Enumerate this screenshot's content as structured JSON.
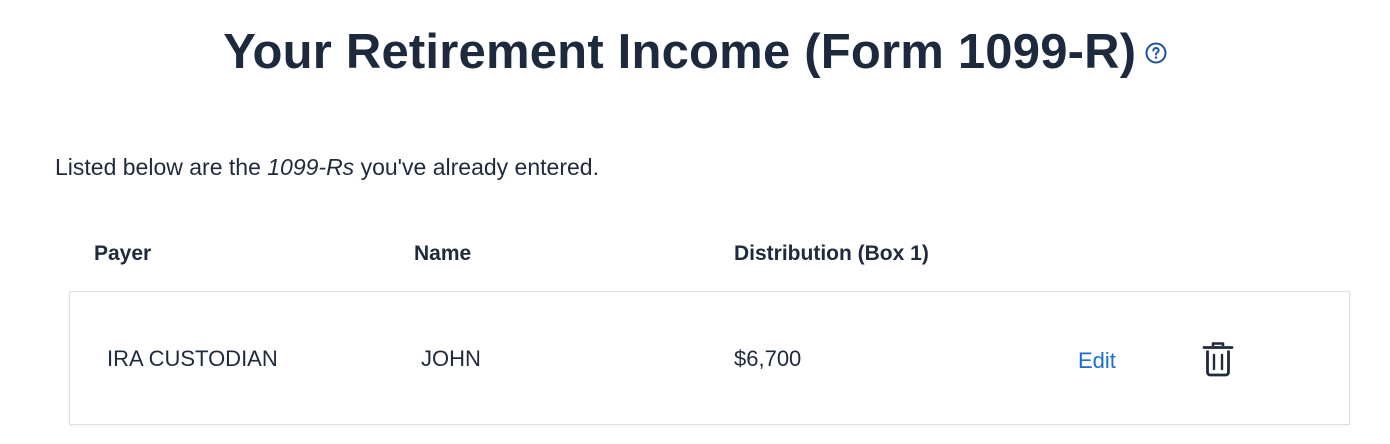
{
  "header": {
    "title": "Your Retirement Income (Form 1099-R)"
  },
  "intro": {
    "prefix": "Listed below are the ",
    "emphasis": "1099-Rs",
    "suffix": " you've already entered."
  },
  "table": {
    "columns": [
      "Payer",
      "Name",
      "Distribution (Box 1)"
    ],
    "rows": [
      {
        "payer": "IRA CUSTODIAN",
        "name": "JOHN",
        "distribution": "$6,700",
        "edit_label": "Edit"
      }
    ]
  },
  "colors": {
    "title": "#1d2a3e",
    "text": "#1f2a3d",
    "link": "#1a6fd1",
    "help_icon": "#1a4fa3",
    "card_border": "#dde1e6"
  },
  "icons": {
    "help": "question-circle-icon",
    "delete": "trash-icon"
  }
}
